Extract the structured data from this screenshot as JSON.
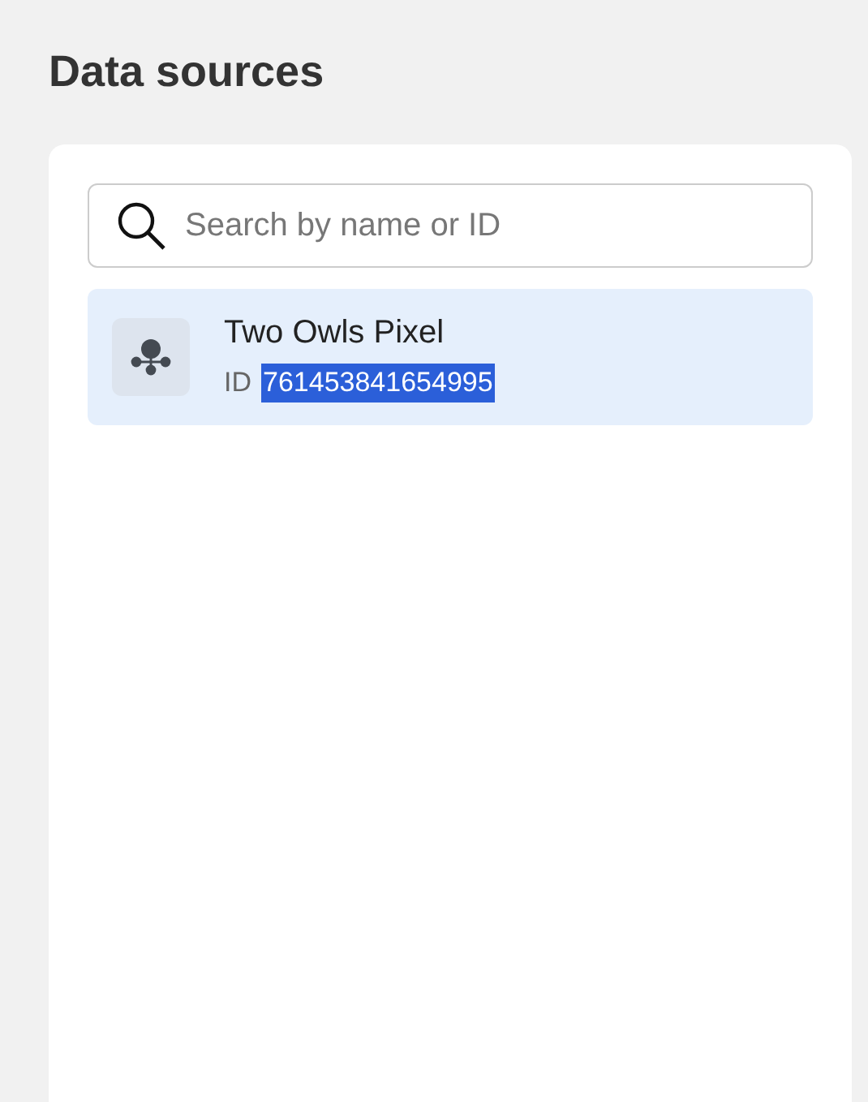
{
  "title": "Data sources",
  "search": {
    "placeholder": "Search by name or ID"
  },
  "sources": [
    {
      "name": "Two Owls Pixel",
      "id_label": "ID",
      "id": "761453841654995",
      "selected": true,
      "id_highlighted": true
    }
  ]
}
